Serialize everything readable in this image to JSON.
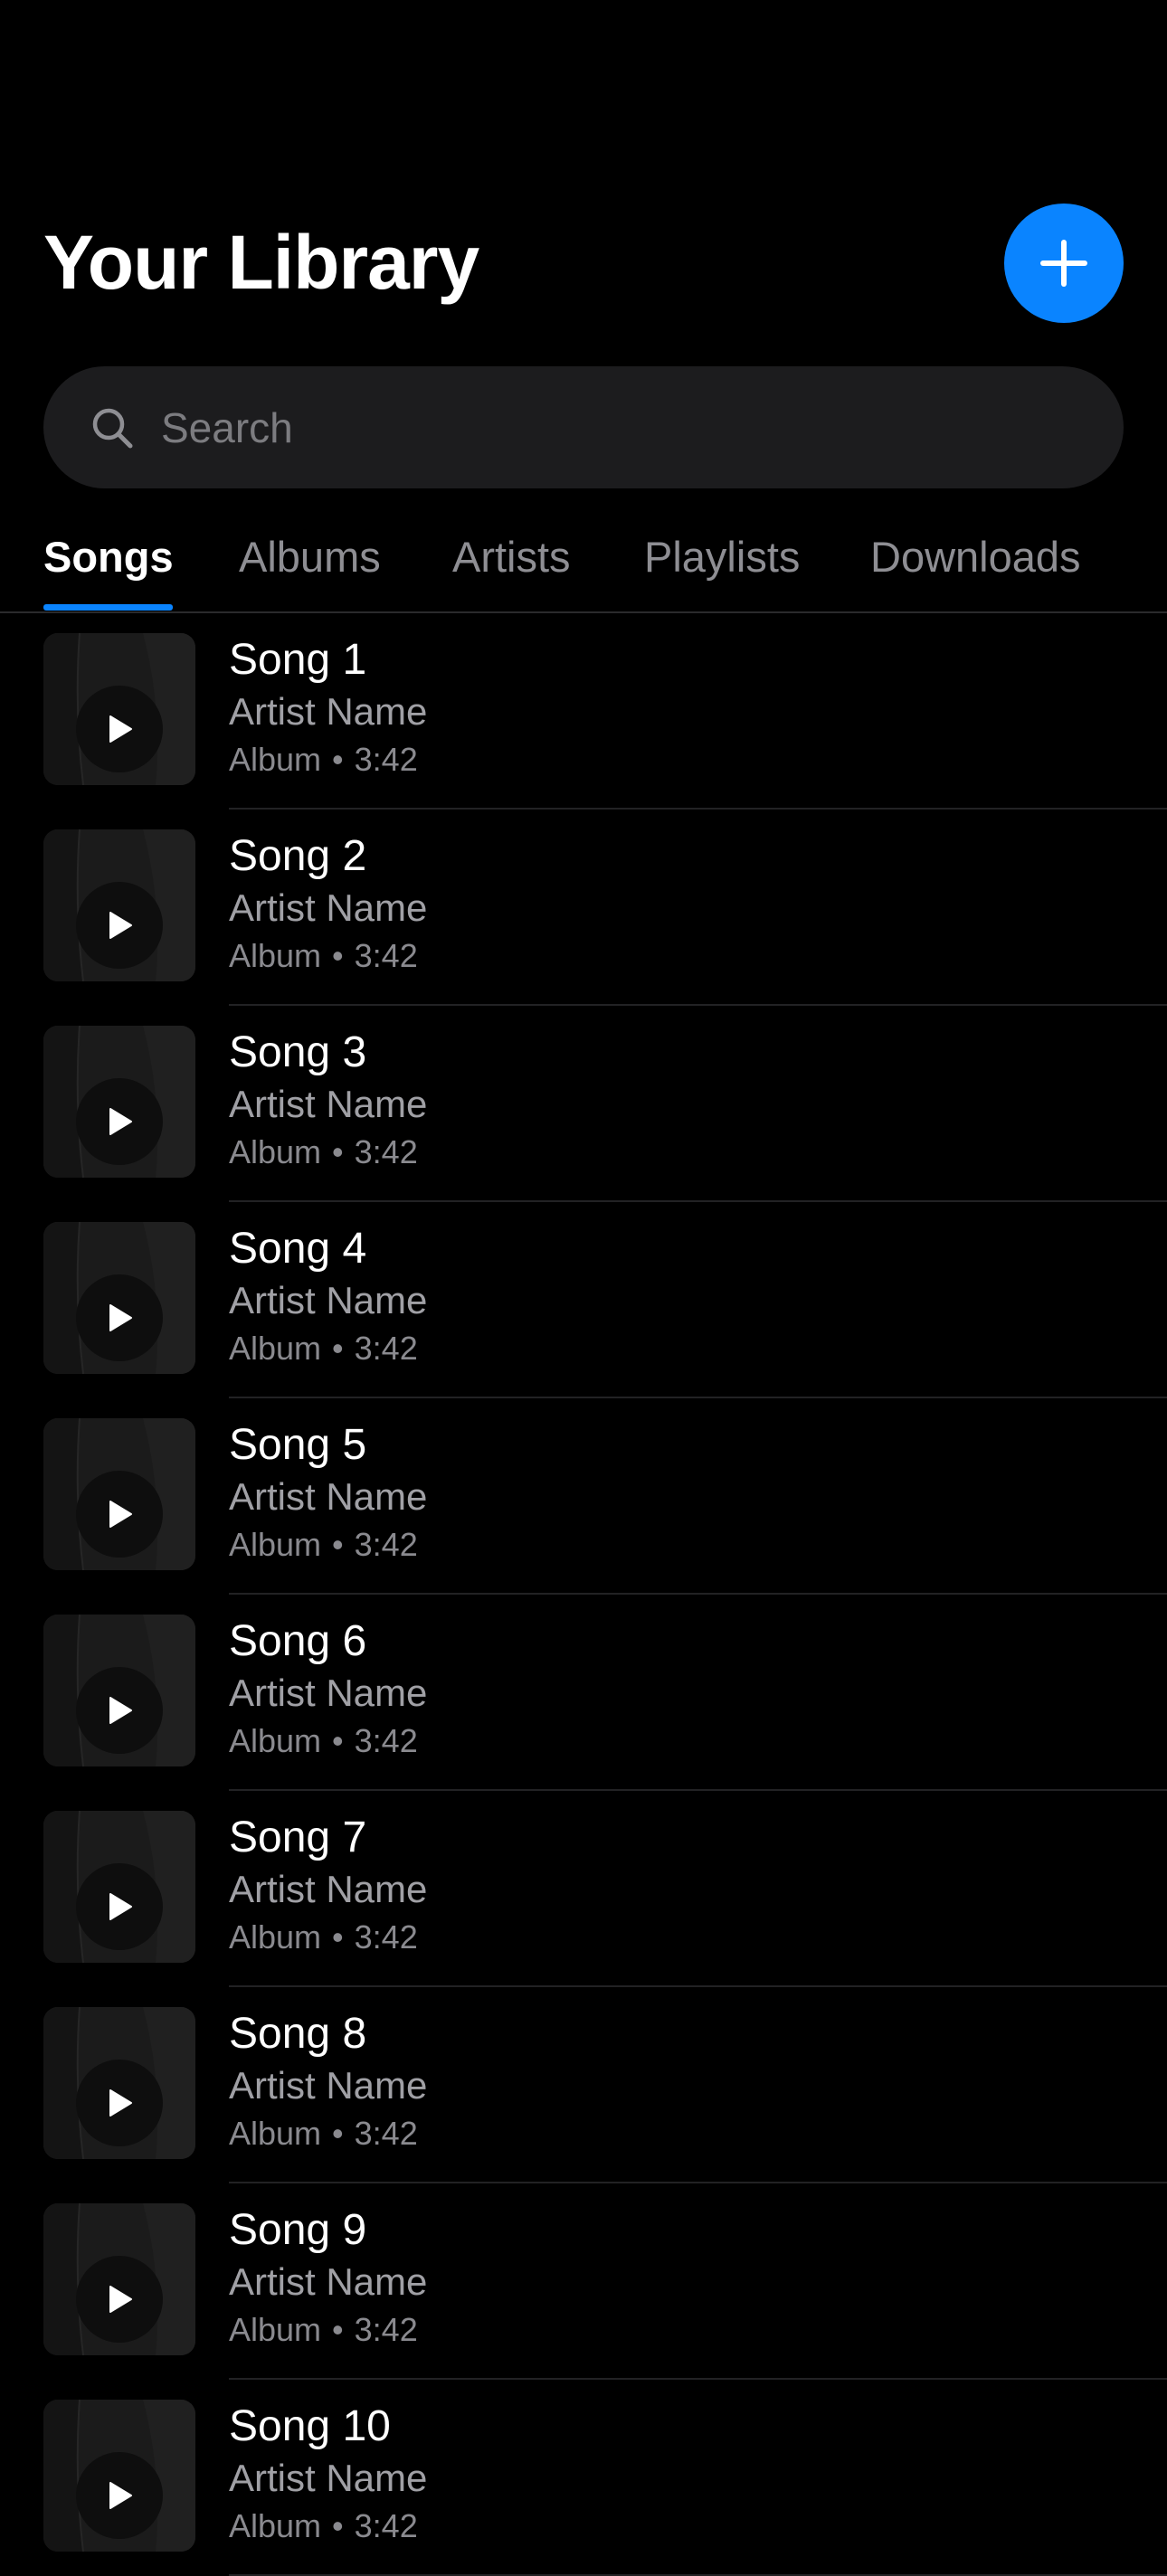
{
  "header": {
    "title": "Your Library",
    "add_icon": "plus-icon",
    "accent_color": "#0A84FF"
  },
  "search": {
    "placeholder": "Search",
    "value": "",
    "icon": "search-icon"
  },
  "tabs": [
    {
      "label": "Songs",
      "active": true
    },
    {
      "label": "Albums",
      "active": false
    },
    {
      "label": "Artists",
      "active": false
    },
    {
      "label": "Playlists",
      "active": false
    },
    {
      "label": "Downloads",
      "active": false
    }
  ],
  "songs": [
    {
      "title": "Song 1",
      "artist": "Artist Name",
      "album": "Album",
      "duration": "3:42"
    },
    {
      "title": "Song 2",
      "artist": "Artist Name",
      "album": "Album",
      "duration": "3:42"
    },
    {
      "title": "Song 3",
      "artist": "Artist Name",
      "album": "Album",
      "duration": "3:42"
    },
    {
      "title": "Song 4",
      "artist": "Artist Name",
      "album": "Album",
      "duration": "3:42"
    },
    {
      "title": "Song 5",
      "artist": "Artist Name",
      "album": "Album",
      "duration": "3:42"
    },
    {
      "title": "Song 6",
      "artist": "Artist Name",
      "album": "Album",
      "duration": "3:42"
    },
    {
      "title": "Song 7",
      "artist": "Artist Name",
      "album": "Album",
      "duration": "3:42"
    },
    {
      "title": "Song 8",
      "artist": "Artist Name",
      "album": "Album",
      "duration": "3:42"
    },
    {
      "title": "Song 9",
      "artist": "Artist Name",
      "album": "Album",
      "duration": "3:42"
    },
    {
      "title": "Song 10",
      "artist": "Artist Name",
      "album": "Album",
      "duration": "3:42"
    }
  ],
  "meta_separator": "•",
  "artwork_icon": "play-icon"
}
